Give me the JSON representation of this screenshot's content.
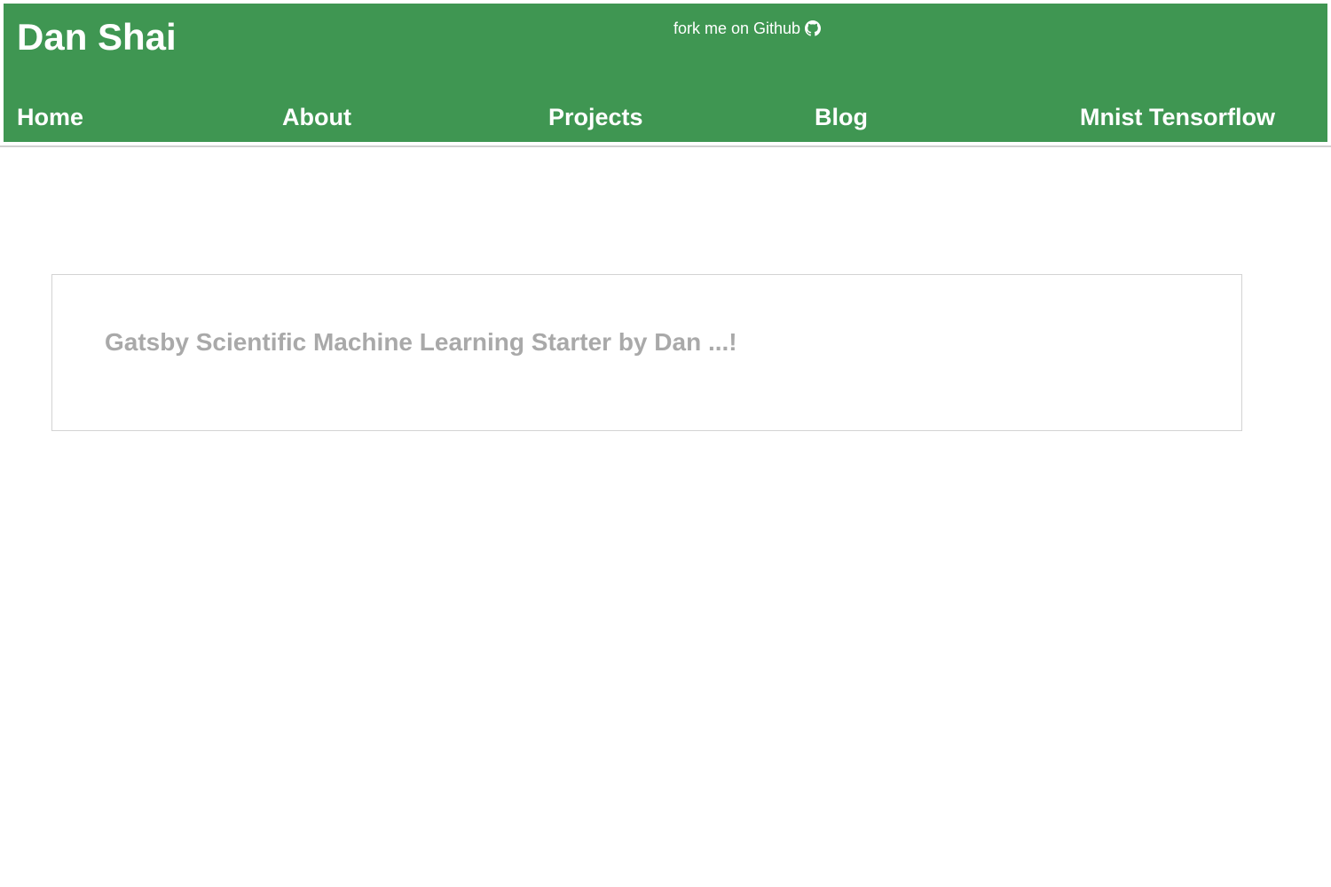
{
  "header": {
    "site_title": "Dan Shai",
    "fork_link": {
      "label": "fork me on Github",
      "icon": "github-icon"
    },
    "nav": [
      {
        "label": "Home"
      },
      {
        "label": "About"
      },
      {
        "label": "Projects"
      },
      {
        "label": "Blog"
      },
      {
        "label": "Mnist Tensorflow"
      }
    ]
  },
  "main": {
    "posts": [
      {
        "title": "Gatsby Scientific Machine Learning Starter by Dan ...!"
      }
    ]
  },
  "colors": {
    "header_bg": "#3f9652",
    "header_text": "#ffffff",
    "card_title": "#a9a9a9",
    "card_border": "#d3d3d3"
  }
}
